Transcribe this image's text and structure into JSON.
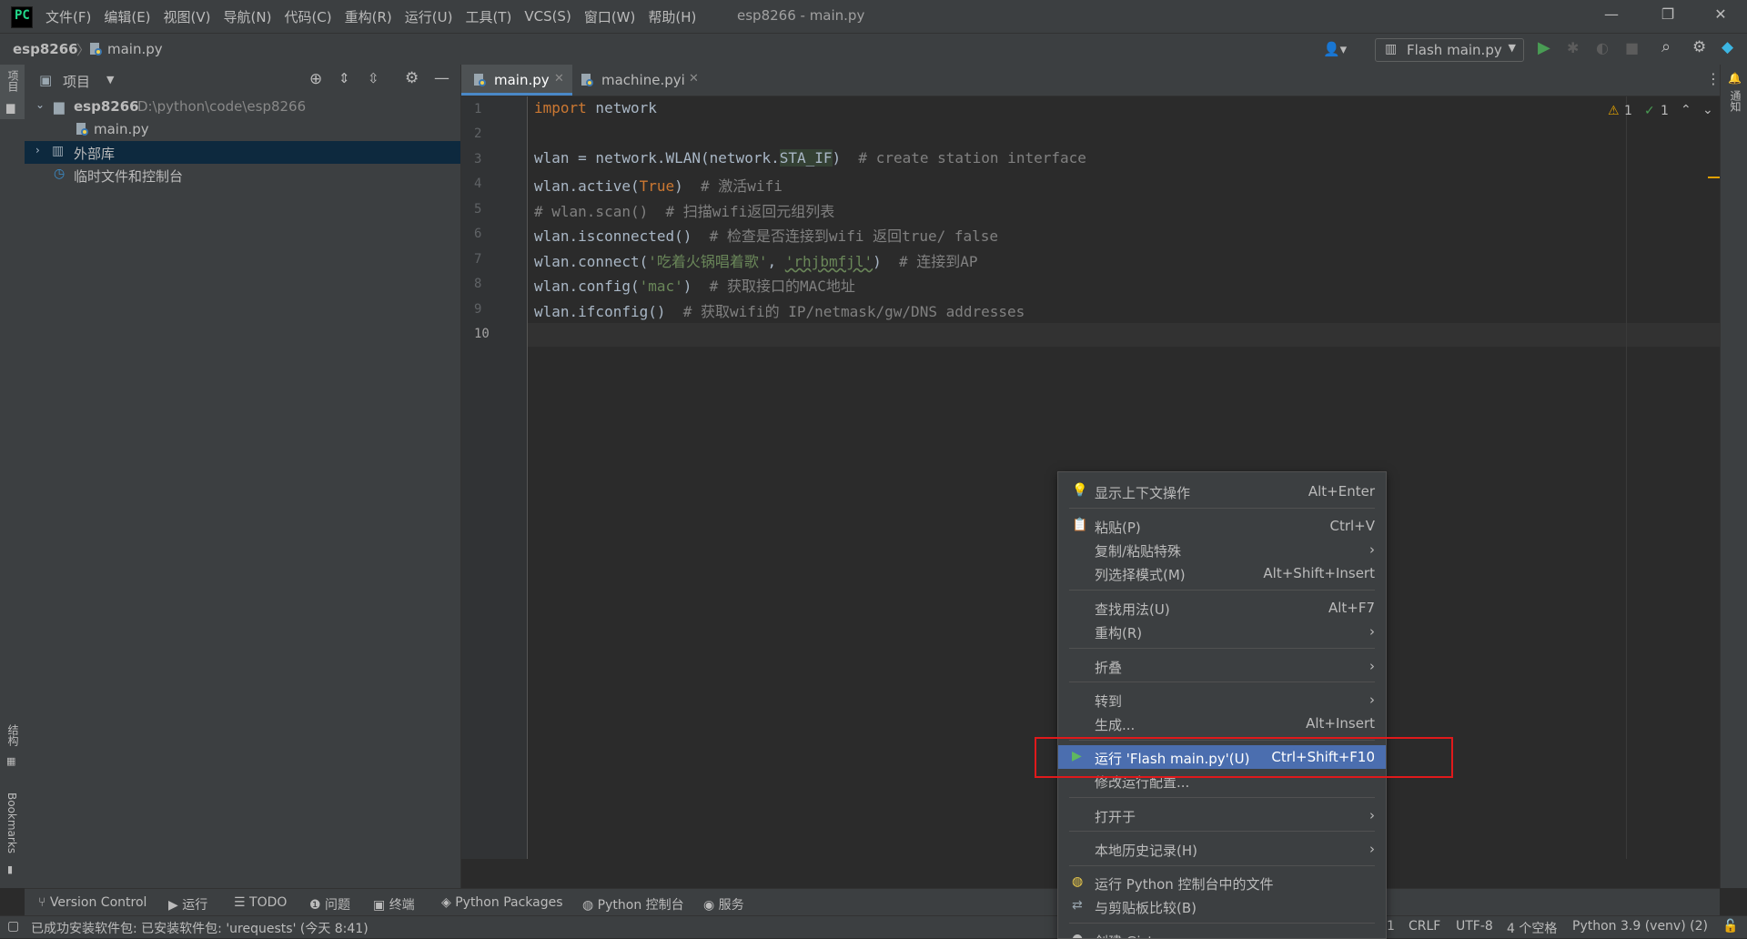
{
  "titlebar": {
    "window_title": "esp8266 - main.py",
    "menus": [
      "文件(F)",
      "编辑(E)",
      "视图(V)",
      "导航(N)",
      "代码(C)",
      "重构(R)",
      "运行(U)",
      "工具(T)",
      "VCS(S)",
      "窗口(W)",
      "帮助(H)"
    ]
  },
  "navbar": {
    "project": "esp8266",
    "file": "main.py",
    "run_config": "Flash main.py"
  },
  "left_strip": {
    "project_tab": "项目",
    "structure_tab": "结构",
    "bookmarks_tab": "Bookmarks"
  },
  "right_strip": {
    "notifications_tab": "通知"
  },
  "project_panel": {
    "title": "项目",
    "root_name": "esp8266",
    "root_path": "D:\\python\\code\\esp8266",
    "file": "main.py",
    "external_libs": "外部库",
    "scratches": "临时文件和控制台"
  },
  "editor": {
    "tabs": [
      "main.py",
      "machine.pyi"
    ],
    "warnings": "1",
    "weak_warnings": "1",
    "line_numbers": [
      "1",
      "2",
      "3",
      "4",
      "5",
      "6",
      "7",
      "8",
      "9",
      "10"
    ],
    "code": {
      "l1_kw": "import",
      "l1_rest": " network",
      "l3_a": "wlan = network.WLAN(network.",
      "l3_b": "STA_IF",
      "l3_c": ")  ",
      "l3_cm": "# create station interface",
      "l4_a": "wlan.active(",
      "l4_kw": "True",
      "l4_b": ")  ",
      "l4_cm": "# 激活wifi",
      "l5_cm": "# wlan.scan()  # 扫描wifi返回元组列表",
      "l6_a": "wlan.isconnected()  ",
      "l6_cm": "# 检查是否连接到wifi 返回true/ false",
      "l7_a": "wlan.connect(",
      "l7_s1": "'吃着火锅唱着歌'",
      "l7_b": ", ",
      "l7_s2": "'rhjbmfjl'",
      "l7_c": ")  ",
      "l7_cm": "# 连接到AP",
      "l8_a": "wlan.config(",
      "l8_s": "'mac'",
      "l8_b": ")  ",
      "l8_cm": "# 获取接口的MAC地址",
      "l9_a": "wlan.ifconfig()  ",
      "l9_cm": "# 获取wifi的 IP/netmask/gw/DNS addresses"
    }
  },
  "context_menu": {
    "show_context_actions": "显示上下文操作",
    "show_context_actions_sc": "Alt+Enter",
    "paste": "粘贴(P)",
    "paste_sc": "Ctrl+V",
    "copy_paste_special": "复制/粘贴特殊",
    "column_mode": "列选择模式(M)",
    "column_mode_sc": "Alt+Shift+Insert",
    "find_usages": "查找用法(U)",
    "find_usages_sc": "Alt+F7",
    "refactor": "重构(R)",
    "folding": "折叠",
    "goto": "转到",
    "generate": "生成...",
    "generate_sc": "Alt+Insert",
    "run": "运行 'Flash main.py'(U)",
    "run_sc": "Ctrl+Shift+F10",
    "modify_run": "修改运行配置...",
    "open_in": "打开于",
    "local_history": "本地历史记录(H)",
    "run_in_console": "运行 Python 控制台中的文件",
    "compare_clipboard": "与剪贴板比较(B)",
    "create_gist": "创建 Gist..."
  },
  "bottom_tools": [
    "Version Control",
    "运行",
    "TODO",
    "问题",
    "终端",
    "Python Packages",
    "Python 控制台",
    "服务"
  ],
  "status_bar": {
    "message": "已成功安装软件包: 已安装软件包: 'urequests' (今天 8:41)",
    "position": "1",
    "line_sep": "CRLF",
    "encoding": "UTF-8",
    "indent": "4 个空格",
    "interpreter": "Python 3.9 (venv) (2)"
  },
  "colors": {
    "accent": "#4b6eaf",
    "highlight_box": "#e0191b",
    "run_green": "#499c54"
  }
}
